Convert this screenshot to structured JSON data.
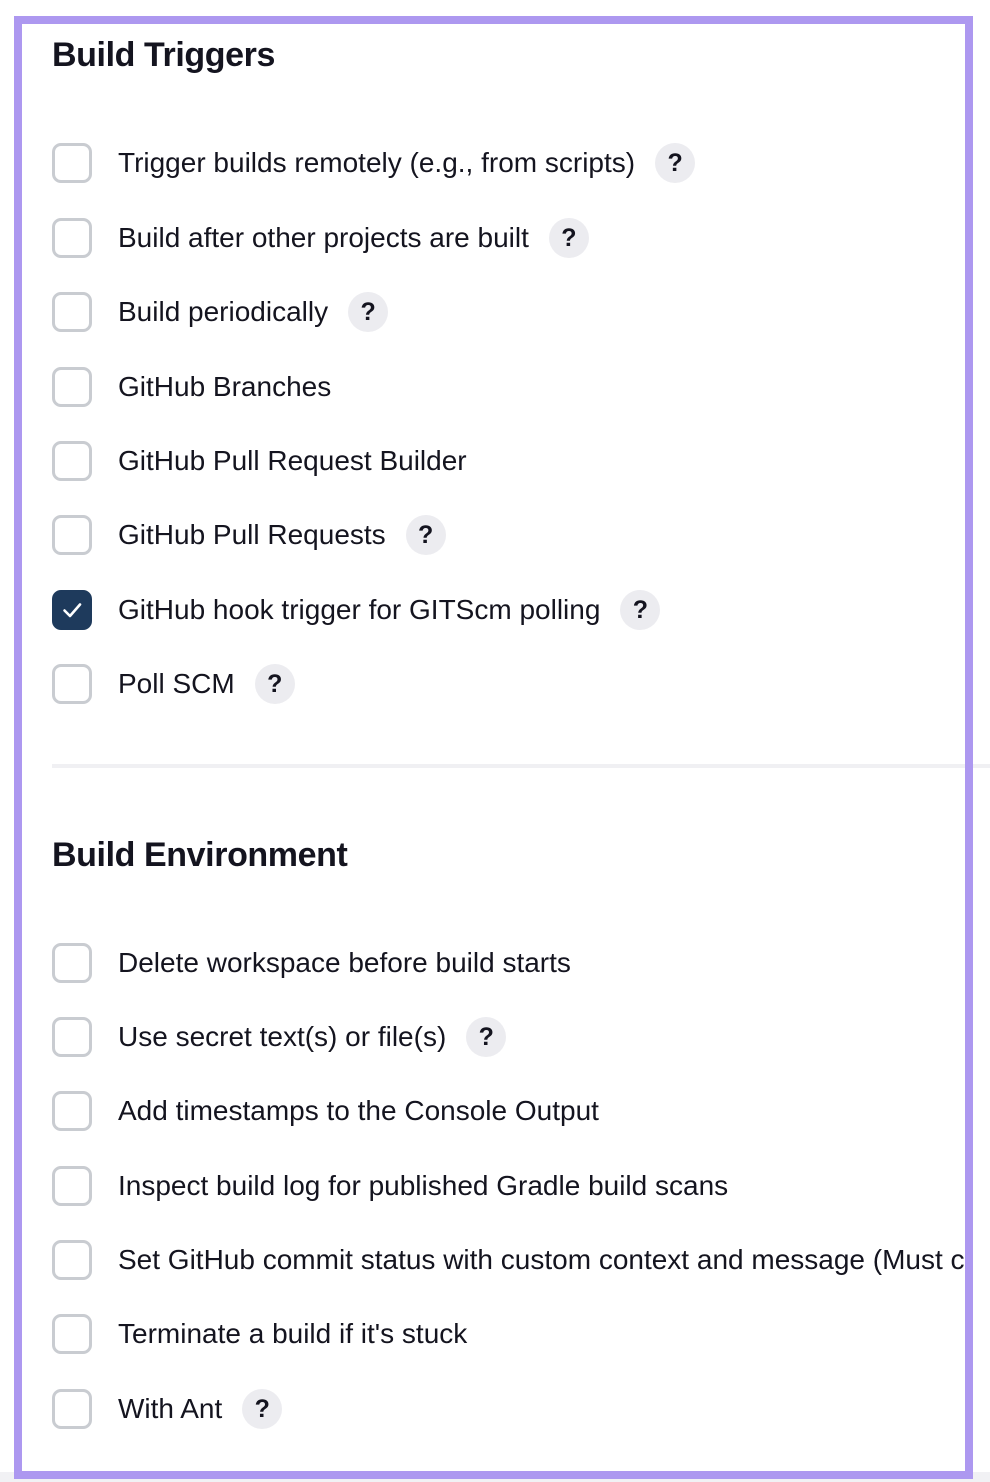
{
  "build_triggers": {
    "title": "Build Triggers",
    "options": [
      {
        "label": "Trigger builds remotely (e.g., from scripts)",
        "checked": false,
        "has_help": true
      },
      {
        "label": "Build after other projects are built",
        "checked": false,
        "has_help": true
      },
      {
        "label": "Build periodically",
        "checked": false,
        "has_help": true
      },
      {
        "label": "GitHub Branches",
        "checked": false,
        "has_help": false
      },
      {
        "label": "GitHub Pull Request Builder",
        "checked": false,
        "has_help": false
      },
      {
        "label": "GitHub Pull Requests",
        "checked": false,
        "has_help": true
      },
      {
        "label": "GitHub hook trigger for GITScm polling",
        "checked": true,
        "has_help": true
      },
      {
        "label": "Poll SCM",
        "checked": false,
        "has_help": true
      }
    ]
  },
  "build_environment": {
    "title": "Build Environment",
    "options": [
      {
        "label": "Delete workspace before build starts",
        "checked": false,
        "has_help": false
      },
      {
        "label": "Use secret text(s) or file(s)",
        "checked": false,
        "has_help": true
      },
      {
        "label": "Add timestamps to the Console Output",
        "checked": false,
        "has_help": false
      },
      {
        "label": "Inspect build log for published Gradle build scans",
        "checked": false,
        "has_help": false
      },
      {
        "label": "Set GitHub commit status with custom context and message (Must c",
        "checked": false,
        "has_help": false
      },
      {
        "label": "Terminate a build if it's stuck",
        "checked": false,
        "has_help": false
      },
      {
        "label": "With Ant",
        "checked": false,
        "has_help": true
      }
    ]
  },
  "help_symbol": "?",
  "icons": {
    "checkbox_checked": "check-icon",
    "help": "question-mark-icon"
  },
  "colors": {
    "frame": "#ad98f0",
    "checkbox_checked": "#1e3a5c",
    "checkbox_border": "#c9ccd1",
    "help_background": "#ececf0"
  }
}
